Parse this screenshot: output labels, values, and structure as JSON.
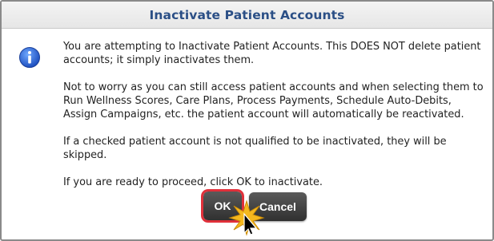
{
  "dialog": {
    "title": "Inactivate Patient Accounts",
    "icon": "info-icon",
    "paragraphs": [
      "You are attempting to Inactivate Patient Accounts. This DOES NOT delete patient accounts; it simply inactivates them.",
      "Not to worry as you can still access patient accounts and when selecting them to Run Wellness Scores, Care Plans, Process Payments, Schedule Auto-Debits, Assign Campaigns, etc. the patient account will automatically be reactivated.",
      "If a checked patient account is not qualified to be inactivated, they will be skipped.",
      "If you are ready to proceed, click OK to inactivate."
    ],
    "buttons": {
      "ok_label": "OK",
      "cancel_label": "Cancel"
    },
    "colors": {
      "title": "#2b4f86",
      "highlight": "#e0303a",
      "button": "#3a3a3a"
    }
  }
}
